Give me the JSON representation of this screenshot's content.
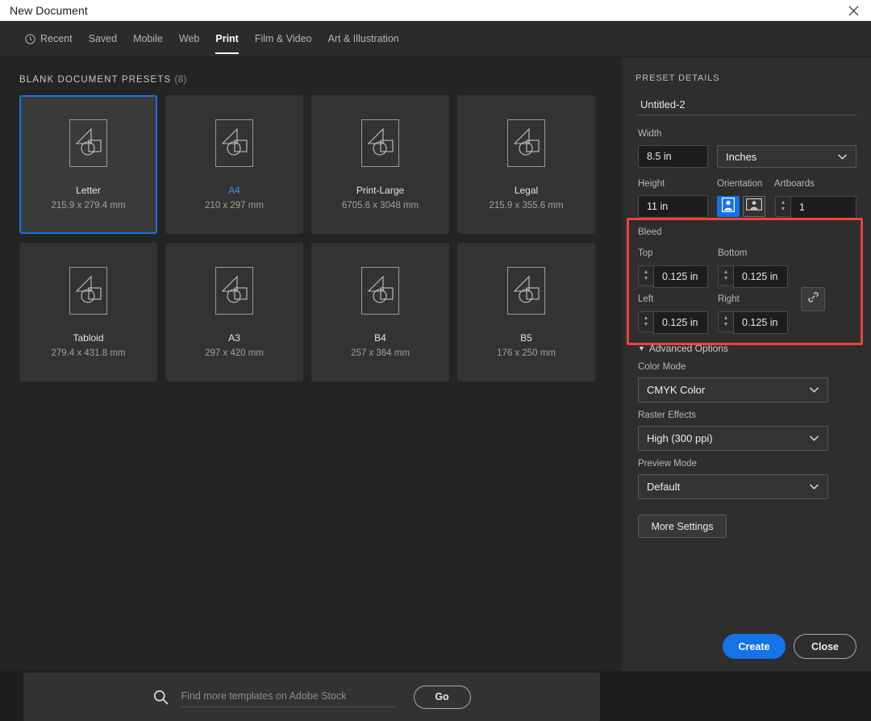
{
  "window": {
    "title": "New Document",
    "close_icon": "close-x-icon"
  },
  "tabs": [
    {
      "label": "Recent",
      "icon": "clock-icon",
      "active": false
    },
    {
      "label": "Saved",
      "active": false
    },
    {
      "label": "Mobile",
      "active": false
    },
    {
      "label": "Web",
      "active": false
    },
    {
      "label": "Print",
      "active": true
    },
    {
      "label": "Film & Video",
      "active": false
    },
    {
      "label": "Art & Illustration",
      "active": false
    }
  ],
  "presets_section": {
    "heading": "BLANK DOCUMENT PRESETS",
    "count": "(8)",
    "cards": [
      {
        "name": "Letter",
        "dims": "215.9 x 279.4 mm",
        "state": "selected"
      },
      {
        "name": "A4",
        "dims": "210 x 297 mm",
        "state": "hovered"
      },
      {
        "name": "Print-Large",
        "dims": "6705.6 x 3048 mm",
        "state": "normal"
      },
      {
        "name": "Legal",
        "dims": "215.9 x 355.6 mm",
        "state": "normal"
      },
      {
        "name": "Tabloid",
        "dims": "279.4 x 431.8 mm",
        "state": "normal"
      },
      {
        "name": "A3",
        "dims": "297 x 420 mm",
        "state": "normal"
      },
      {
        "name": "B4",
        "dims": "257 x 364 mm",
        "state": "normal"
      },
      {
        "name": "B5",
        "dims": "176 x 250 mm",
        "state": "normal"
      }
    ]
  },
  "stock_search": {
    "icon": "search-icon",
    "placeholder": "Find more templates on Adobe Stock",
    "value": "",
    "go_label": "Go"
  },
  "preset_details": {
    "heading": "PRESET DETAILS",
    "document_name": "Untitled-2",
    "width_label": "Width",
    "width_value": "8.5 in",
    "units_value": "Inches",
    "height_label": "Height",
    "height_value": "11 in",
    "orientation_label": "Orientation",
    "orientation_portrait_icon": "portrait-icon",
    "orientation_landscape_icon": "landscape-icon",
    "orientation_selected": "portrait",
    "artboards_label": "Artboards",
    "artboards_value": "1",
    "bleed": {
      "group_label": "Bleed",
      "top_label": "Top",
      "top_value": "0.125 in",
      "bottom_label": "Bottom",
      "bottom_value": "0.125 in",
      "left_label": "Left",
      "left_value": "0.125 in",
      "right_label": "Right",
      "right_value": "0.125 in",
      "link_icon": "link-chain-icon",
      "highlight_color": "#f0413c"
    },
    "advanced_label": "Advanced Options",
    "color_mode_label": "Color Mode",
    "color_mode_value": "CMYK Color",
    "raster_label": "Raster Effects",
    "raster_value": "High (300 ppi)",
    "preview_label": "Preview Mode",
    "preview_value": "Default",
    "more_settings_label": "More Settings"
  },
  "actions": {
    "create_label": "Create",
    "close_label": "Close",
    "accent_color": "#1473e6"
  }
}
